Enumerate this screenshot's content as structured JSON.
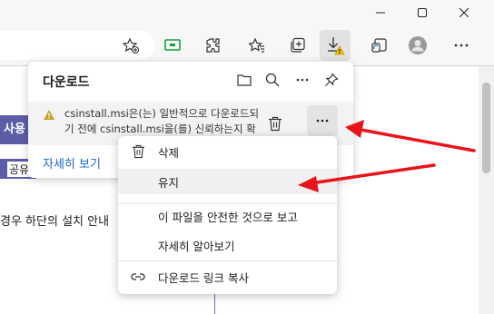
{
  "window": {
    "minimize_icon": "minimize-icon",
    "maximize_icon": "maximize-icon",
    "close_icon": "close-icon"
  },
  "toolbar": {
    "icons": [
      "favorites-add-icon",
      "screencast-icon",
      "extensions-icon",
      "favorites-icon",
      "collections-icon",
      "downloads-icon",
      "share-icon",
      "profile-icon",
      "more-icon"
    ]
  },
  "page": {
    "tab1_label": "사용",
    "tab2_label": "공유",
    "text_line": "경우 하단의 설치 안내"
  },
  "downloads": {
    "title": "다운로드",
    "item_line1": "csinstall.msi은(는) 일반적으로 다운로드되",
    "item_line2": "기 전에 csinstall.msi을(를) 신뢰하는지 확",
    "see_more": "자세히 보기"
  },
  "menu": {
    "delete": "삭제",
    "keep": "유지",
    "report_safe": "이 파일을 안전한 것으로 보고",
    "learn_more": "자세히 알아보기",
    "copy_link": "다운로드 링크 복사"
  },
  "colors": {
    "accent": "#5b5ea6",
    "link": "#1a64c8",
    "warning": "#c8a22a",
    "arrow": "#e8141c"
  }
}
